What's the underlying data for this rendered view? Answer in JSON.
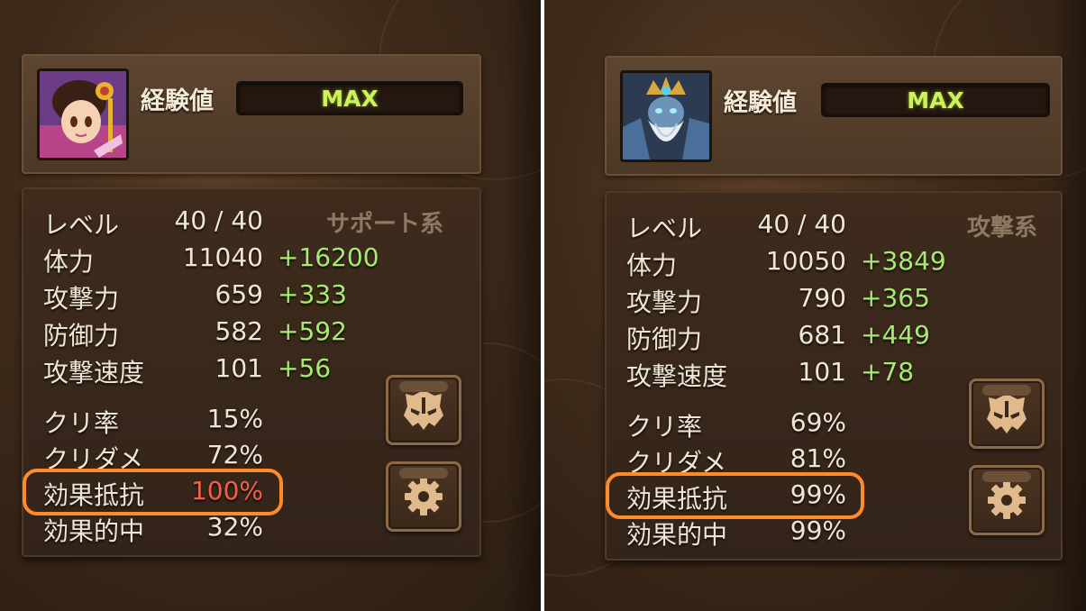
{
  "panels": [
    {
      "id": "left",
      "exp_label": "経験値",
      "exp_value": "MAX",
      "class_type": "サポート系",
      "stats": [
        {
          "label": "レベル",
          "value": "40 / 40",
          "bonus": ""
        },
        {
          "label": "体力",
          "value": "11040",
          "bonus": "+16200"
        },
        {
          "label": "攻撃力",
          "value": "659",
          "bonus": "+333"
        },
        {
          "label": "防御力",
          "value": "582",
          "bonus": "+592"
        },
        {
          "label": "攻撃速度",
          "value": "101",
          "bonus": "+56"
        }
      ],
      "secondary": [
        {
          "label": "クリ率",
          "value": "15%"
        },
        {
          "label": "クリダメ",
          "value": "72%"
        },
        {
          "label": "効果抵抗",
          "value": "100%"
        },
        {
          "label": "効果的中",
          "value": "32%"
        }
      ],
      "portrait_icon": "female-monster-portrait",
      "buttons": [
        {
          "icon": "monster-mask-icon"
        },
        {
          "icon": "gear-icon"
        }
      ]
    },
    {
      "id": "right",
      "exp_label": "経験値",
      "exp_value": "MAX",
      "class_type": "攻撃系",
      "stats": [
        {
          "label": "レベル",
          "value": "40 / 40",
          "bonus": ""
        },
        {
          "label": "体力",
          "value": "10050",
          "bonus": "+3849"
        },
        {
          "label": "攻撃力",
          "value": "790",
          "bonus": "+365"
        },
        {
          "label": "防御力",
          "value": "681",
          "bonus": "+449"
        },
        {
          "label": "攻撃速度",
          "value": "101",
          "bonus": "+78"
        }
      ],
      "secondary": [
        {
          "label": "クリ率",
          "value": "69%"
        },
        {
          "label": "クリダメ",
          "value": "81%"
        },
        {
          "label": "効果抵抗",
          "value": "99%"
        },
        {
          "label": "効果的中",
          "value": "99%"
        }
      ],
      "portrait_icon": "bearded-king-monster-portrait",
      "buttons": [
        {
          "icon": "monster-mask-icon"
        },
        {
          "icon": "gear-icon"
        }
      ]
    }
  ],
  "colors": {
    "exp_text": "#ccf25a",
    "bonus_text": "#a6ea74",
    "highlight_value": "#f0604a",
    "highlight_outline": "#ff8a29",
    "class_type_text": "#8d7a64"
  }
}
